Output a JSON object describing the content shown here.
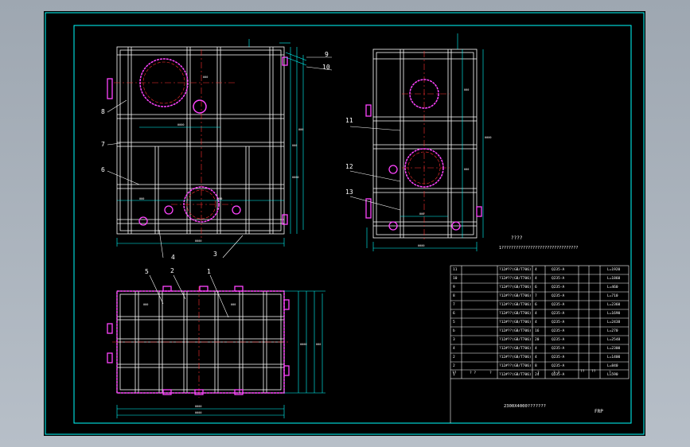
{
  "colors": {
    "background": "#000000",
    "frame": "#00ffff",
    "structure": "#ffffff",
    "center_line": "#ff3030",
    "flange": "#ff44ff",
    "dimension": "#00ffff",
    "leader": "#ffffff"
  },
  "front_view_labels": [
    "8",
    "7",
    "6",
    "4",
    "3",
    "9",
    "10"
  ],
  "side_view_labels": [
    "11",
    "12",
    "13"
  ],
  "plan_view_labels": [
    "5",
    "2",
    "1"
  ],
  "notes": {
    "heading": "????",
    "line": "1????????????????????????????????"
  },
  "bom": {
    "rows": [
      {
        "no": "11",
        "spec": "?12#??(GB/T706)",
        "qty": "4",
        "material": "Q235-A",
        "length": "L=1920"
      },
      {
        "no": "10",
        "spec": "?12#??(GB/T706)",
        "qty": "4",
        "material": "Q235-A",
        "length": "L=1860"
      },
      {
        "no": "9",
        "spec": "?12#??(GB/T706)",
        "qty": "6",
        "material": "Q235-A",
        "length": "L=460"
      },
      {
        "no": "8",
        "spec": "?12#??(GB/T706)",
        "qty": "7",
        "material": "Q235-A",
        "length": "L=710"
      },
      {
        "no": "7",
        "spec": "?12#??(GB/T706)",
        "qty": "6",
        "material": "Q235-A",
        "length": "L=2360"
      },
      {
        "no": "6",
        "spec": "?12#??(GB/T706)",
        "qty": "4",
        "material": "Q235-A",
        "length": "L=1690"
      },
      {
        "no": "5",
        "spec": "?12#??(GB/T706)",
        "qty": "4",
        "material": "Q235-A",
        "length": "L=2438"
      },
      {
        "no": "b",
        "spec": "?12#??(GB/T706)",
        "qty": "16",
        "material": "Q235-A",
        "length": "L=270"
      },
      {
        "no": "3",
        "spec": "?12#??(GB/T706)",
        "qty": "20",
        "material": "Q235-A",
        "length": "L=2548"
      },
      {
        "no": "4",
        "spec": "?12#??(GB/T706)",
        "qty": "4",
        "material": "Q235-A",
        "length": "L=2300"
      },
      {
        "no": "2",
        "spec": "?12#??(GB/T706)",
        "qty": "4",
        "material": "Q235-A",
        "length": "L=1400"
      },
      {
        "no": "2",
        "spec": "?12#??(GB/T706)",
        "qty": "8",
        "material": "Q235-A",
        "length": "L=840"
      },
      {
        "no": "1",
        "spec": "?12#??(GB/T706)",
        "qty": "24",
        "material": "Q235-A",
        "length": "L=590"
      }
    ],
    "header": {
      "c1": "??",
      "c2": "?  ?",
      "c3": "?",
      "c4": "?",
      "c5": "? ?",
      "c6": "??",
      "c7": "??",
      "c8": "?"
    }
  },
  "title_block": {
    "drawing_title": "2300X4000???????",
    "code": "FRP"
  }
}
